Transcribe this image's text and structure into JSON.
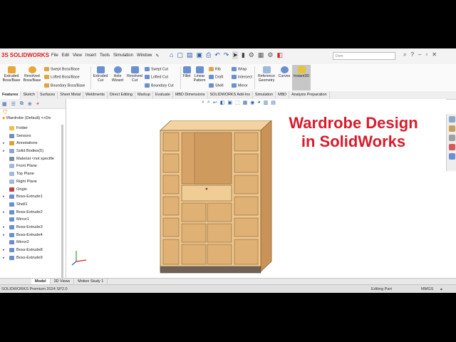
{
  "app": {
    "logo": "SOLIDWORKS",
    "menus": [
      "File",
      "Edit",
      "View",
      "Insert",
      "Tools",
      "Simulation",
      "Window"
    ],
    "search_placeholder": "Dom"
  },
  "ribbon": {
    "extruded_boss": "Extruded Boss/Base",
    "revolved_boss": "Revolved Boss/Base",
    "swept_boss": "Swept Boss/Base",
    "lofted_boss": "Lofted Boss/Base",
    "boundary_boss": "Boundary Boss/Base",
    "extruded_cut": "Extruded Cut",
    "hole_wizard": "Hole Wizard",
    "revolved_cut": "Revolved Cut",
    "swept_cut": "Swept Cut",
    "lofted_cut": "Lofted Cut",
    "boundary_cut": "Boundary Cut",
    "fillet": "Fillet",
    "linear_pattern": "Linear Pattern",
    "rib": "Rib",
    "draft": "Draft",
    "shell": "Shell",
    "wrap": "Wrap",
    "intersect": "Intersect",
    "mirror": "Mirror",
    "reference_geometry": "Reference Geometry",
    "curves": "Curves",
    "instant3d": "Instant3D"
  },
  "tabs": [
    "Features",
    "Sketch",
    "Surfaces",
    "Sheet Metal",
    "Weldments",
    "Direct Editing",
    "Markup",
    "Evaluate",
    "MBD Dimensions",
    "SOLIDWORKS Add-Ins",
    "Simulation",
    "MBD",
    "Analysis Preparation"
  ],
  "tree": {
    "root": "Wardrobe (Default) <<De",
    "items": [
      {
        "label": "Folder",
        "arrow": "",
        "color": "#e8c24a"
      },
      {
        "label": "Sensors",
        "arrow": "",
        "color": "#6d8fc0"
      },
      {
        "label": "Annotations",
        "arrow": "▸",
        "color": "#e0a030"
      },
      {
        "label": "Solid Bodies(5)",
        "arrow": "▸",
        "color": "#8aa6c8"
      },
      {
        "label": "Material <not specifie",
        "arrow": "",
        "color": "#7a8ea8"
      },
      {
        "label": "Front Plane",
        "arrow": "",
        "color": "#9fb9d8"
      },
      {
        "label": "Top Plane",
        "arrow": "",
        "color": "#9fb9d8"
      },
      {
        "label": "Right Plane",
        "arrow": "",
        "color": "#9fb9d8"
      },
      {
        "label": "Origin",
        "arrow": "",
        "color": "#c04040"
      },
      {
        "label": "Boss-Extrude1",
        "arrow": "▸",
        "color": "#6a8fcc"
      },
      {
        "label": "Shell1",
        "arrow": "",
        "color": "#6a8fcc"
      },
      {
        "label": "Boss-Extrude2",
        "arrow": "▸",
        "color": "#6a8fcc"
      },
      {
        "label": "Mirror1",
        "arrow": "",
        "color": "#6a8fcc"
      },
      {
        "label": "Boss-Extrude3",
        "arrow": "▸",
        "color": "#6a8fcc"
      },
      {
        "label": "Boss-Extrude4",
        "arrow": "▸",
        "color": "#6a8fcc"
      },
      {
        "label": "Mirror2",
        "arrow": "",
        "color": "#6a8fcc"
      },
      {
        "label": "Boss-Extrude8",
        "arrow": "▸",
        "color": "#6a8fcc"
      },
      {
        "label": "Boss-Extrude9",
        "arrow": "▸",
        "color": "#6a8fcc"
      }
    ]
  },
  "viewport": {
    "title_line1": "Wardrobe Design",
    "title_line2": "in SolidWorks"
  },
  "bottom_tabs": [
    "Model",
    "3D Views",
    "Motion Study 1"
  ],
  "status": {
    "product": "SOLIDWORKS Premium 2024 SP2.0",
    "mode": "Editing Part",
    "units": "MMGS"
  },
  "colors": {
    "title_red": "#d81c2c",
    "wood_light": "#f1cd96",
    "wood_mid": "#e6b87a",
    "wood_dark": "#c99358"
  }
}
